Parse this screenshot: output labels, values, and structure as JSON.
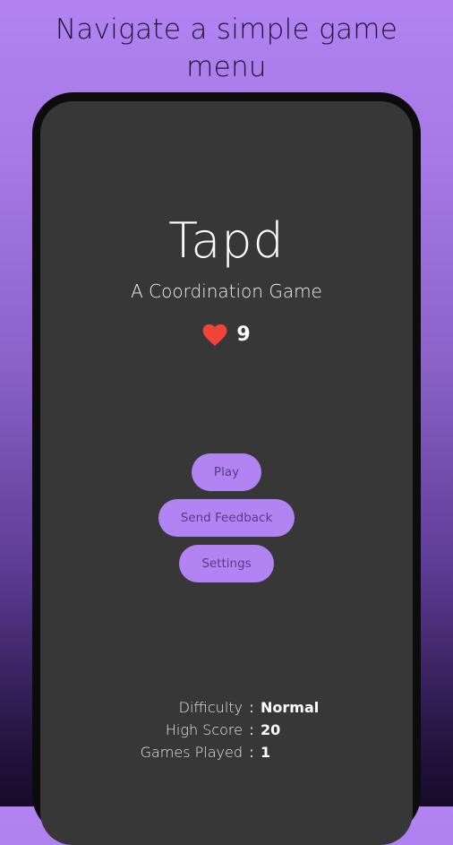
{
  "promo": {
    "caption": "Navigate a simple game menu"
  },
  "app": {
    "title": "Tapd",
    "subtitle": "A Coordination Game",
    "lives": {
      "icon": "heart-icon",
      "icon_color": "#f04438",
      "count": "9"
    }
  },
  "menu": {
    "play_label": "Play",
    "feedback_label": "Send Feedback",
    "settings_label": "Settings"
  },
  "stats": {
    "separator": ":",
    "difficulty_label": "Difficulty",
    "difficulty_value": "Normal",
    "high_score_label": "High Score",
    "high_score_value": "20",
    "games_played_label": "Games Played",
    "games_played_value": "1"
  },
  "colors": {
    "accent": "#b283f2",
    "button_text": "#5a3a86",
    "screen_background": "#373737",
    "phone_frame": "#0c0c0c"
  }
}
